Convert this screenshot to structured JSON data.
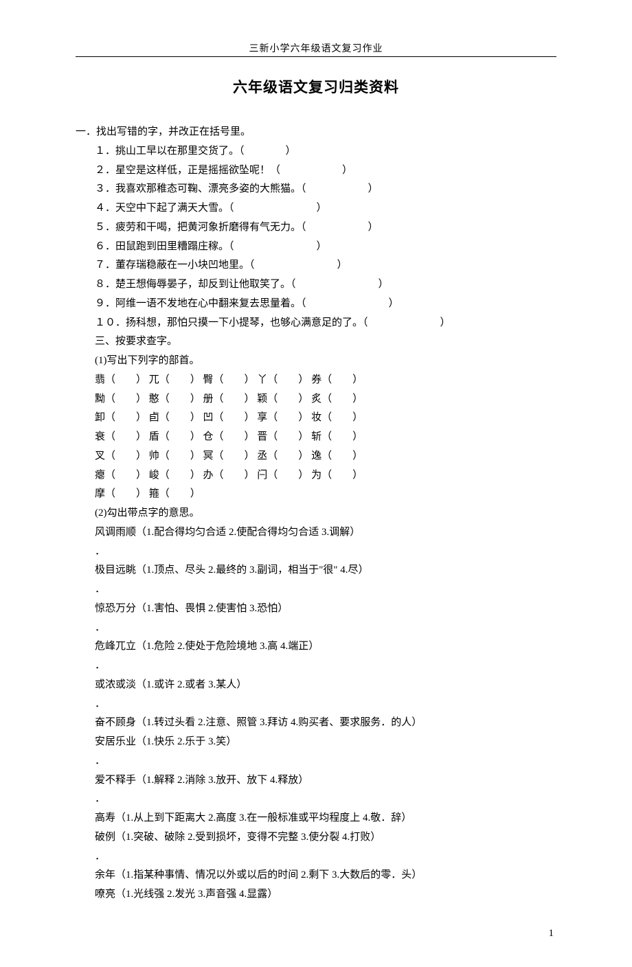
{
  "header": "三新小学六年级语文复习作业",
  "title": "六年级语文复习归类资料",
  "section1": {
    "heading": "一．找出写错的字，并改正在括号里。",
    "items": [
      "１．挑山工早以在那里交货了。（　　　　）",
      "２．星空是这样低，正是摇摇欲坠呢！（　　　　　　）",
      "３．我喜欢那稚态可鞠、漂亮多姿的大熊猫。（　　　　　　）",
      "４．天空中下起了满天大雪。（　　　　　　　　）",
      "５．疲劳和干喝，把黄河象折磨得有气无力。（　　　　　　）",
      "６．田鼠跑到田里糟蹋庄稼。（　　　　　　　　）",
      "７．董存瑞稳蔽在一小块凹地里。（　　　　　　　　）",
      "８．楚王想侮辱晏子，却反到让他取笑了。（　　　　　　　　）",
      "９．阿维一语不发地在心中翻来复去思量着。（　　　　　　　　）",
      "１０．扬科想，那怕只摸一下小提琴，也够心满意足的了。（　　　　　　　）"
    ]
  },
  "section3": {
    "heading": "三、按要求查字。",
    "part1": {
      "heading": "(1)写出下列字的部首。",
      "rows": [
        [
          "翡（　　）",
          "兀（　　）",
          "臀（　　）",
          "丫（　　）",
          "券（　　）"
        ],
        [
          "黝（　　）",
          "憨（　　）",
          "册（　　）",
          "颖（　　）",
          "炙（　　）"
        ],
        [
          "卸（　　）",
          "卣（　　）",
          "凹（　　）",
          "享（　　）",
          "妆（　　）"
        ],
        [
          "衰（　　）",
          "盾（　　）",
          "仓（　　）",
          "晋（　　）",
          "斩（　　）"
        ],
        [
          "叉（　　）",
          "帅（　　）",
          "冥（　　）",
          "丞（　　）",
          "逸（　　）"
        ],
        [
          "瘪（　　）",
          "峻（　　）",
          "办（　　）",
          "闩（　　）",
          "为（　　）"
        ],
        [
          "摩（　　）",
          "箍（　　）"
        ]
      ]
    },
    "part2": {
      "heading": "(2)勾出带点字的意思。",
      "entries": [
        "风调雨顺（1.配合得均匀合适 2.使配合得均匀合适 3.调解）",
        "．",
        "极目远眺（1.顶点、尽头 2.最终的 3.副词，相当于\"很\" 4.尽）",
        "．",
        "惊恐万分（1.害怕、畏惧 2.使害怕 3.恐怕）",
        "．",
        "危峰兀立（1.危险 2.使处于危险境地 3.高 4.端正）",
        "．",
        "或浓或淡（1.或许 2.或者 3.某人）",
        "．",
        "奋不顾身（1.转过头看 2.注意、照管 3.拜访 4.购买者、要求服务．的人）",
        "安居乐业（1.快乐 2.乐于 3.笑）",
        "．",
        "爱不释手（1.解释 2.消除 3.放开、放下 4.释放）",
        "．",
        "高寿（1.从上到下距离大 2.高度 3.在一般标准或平均程度上 4.敬．辞）",
        "破例（1.突破、破除 2.受到损坏，变得不完整 3.使分裂 4.打败）",
        "．",
        "余年（1.指某种事情、情况以外或以后的时间 2.剩下 3.大数后的零．头）",
        "嘹亮（1.光线强 2.发光 3.声音强 4.显露）"
      ]
    }
  },
  "pageNumber": "1"
}
